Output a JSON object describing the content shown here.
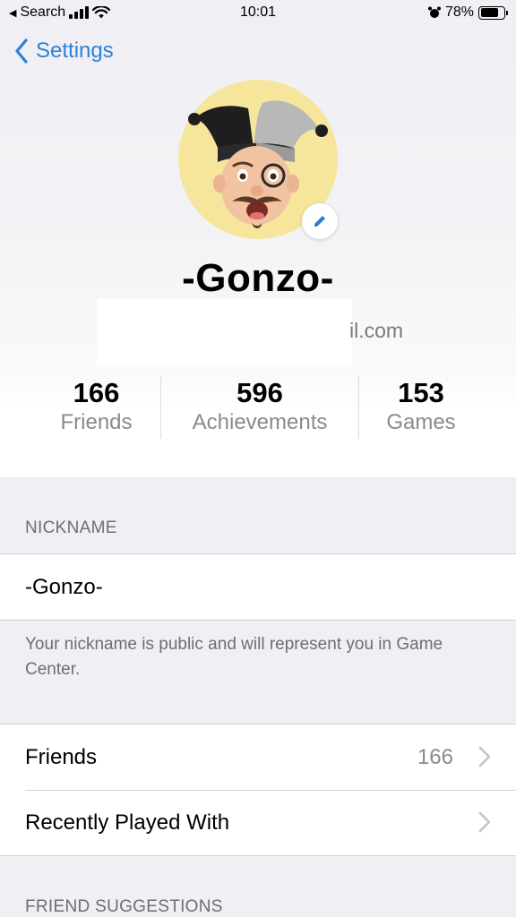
{
  "status_bar": {
    "back_app": "Search",
    "time": "10:01",
    "battery_percent_label": "78%",
    "battery_level": 0.78
  },
  "nav": {
    "back_label": "Settings"
  },
  "profile": {
    "name": "-Gonzo-",
    "email_partial": "il.com",
    "accent_color": "#2d7fd8"
  },
  "stats": [
    {
      "value": "166",
      "label": "Friends"
    },
    {
      "value": "596",
      "label": "Achievements"
    },
    {
      "value": "153",
      "label": "Games"
    }
  ],
  "nickname_section": {
    "header": "NICKNAME",
    "value": "-Gonzo-",
    "footer": "Your nickname is public and will represent you in Game Center."
  },
  "friends_section": {
    "friends_label": "Friends",
    "friends_count": "166",
    "recent_label": "Recently Played With"
  },
  "suggestions_header": "FRIEND SUGGESTIONS",
  "icons": {
    "back": "chevron-left-icon",
    "edit": "pencil-icon",
    "row": "chevron-right-icon",
    "alarm": "alarm-icon",
    "signal": "signal-icon",
    "wifi": "wifi-icon",
    "battery": "battery-icon"
  }
}
